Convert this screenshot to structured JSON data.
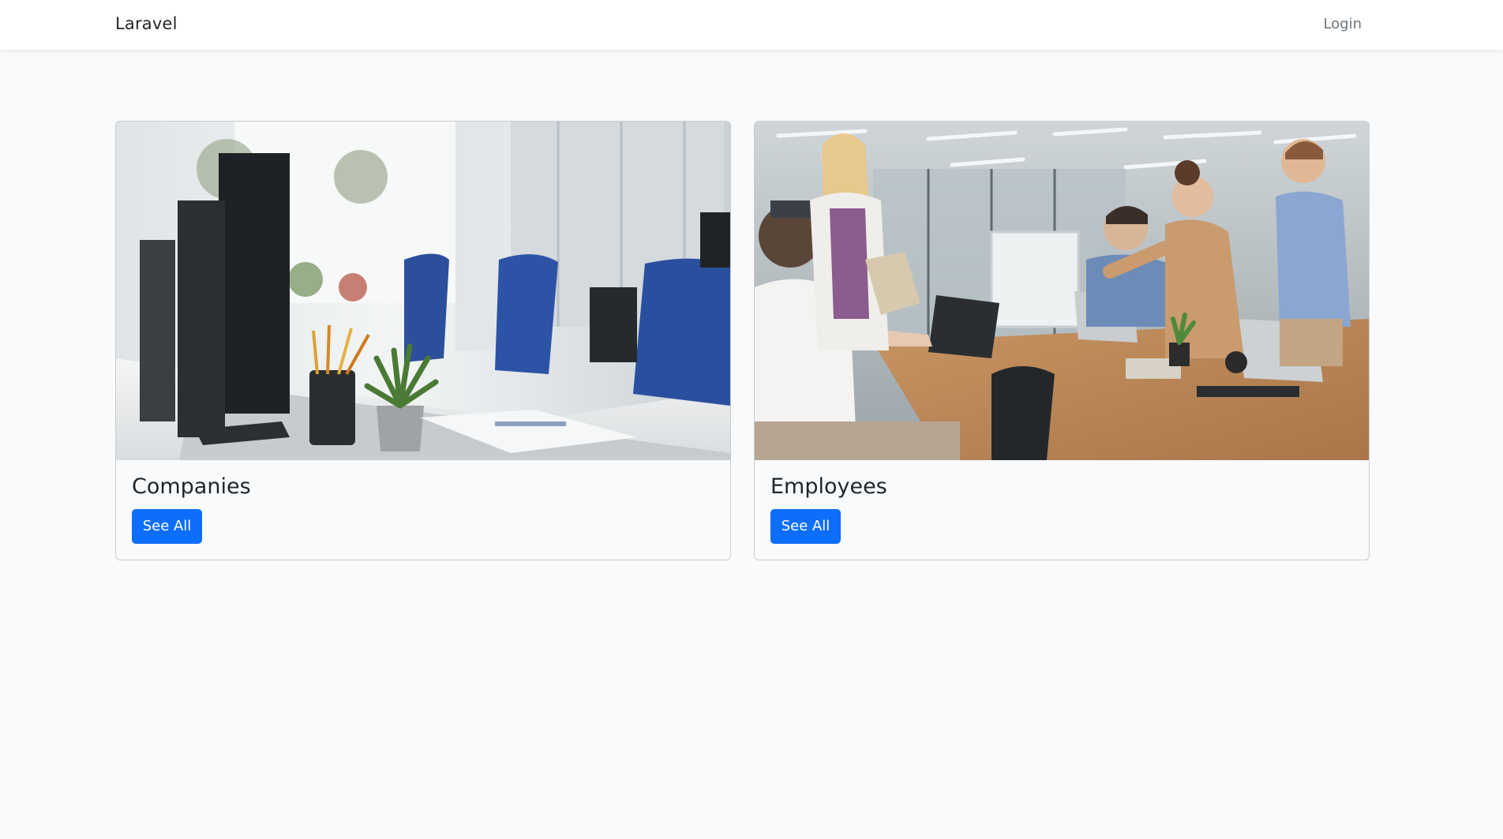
{
  "navbar": {
    "brand": "Laravel",
    "login_label": "Login"
  },
  "cards": [
    {
      "title": "Companies",
      "button_label": "See All",
      "image": "office-desks-photo"
    },
    {
      "title": "Employees",
      "button_label": "See All",
      "image": "team-meeting-photo"
    }
  ],
  "colors": {
    "page_background": "#f8fafc",
    "navbar_background": "#ffffff",
    "primary_button": "#0d6efd",
    "text": "#212529",
    "muted_link": "#6c757d"
  }
}
